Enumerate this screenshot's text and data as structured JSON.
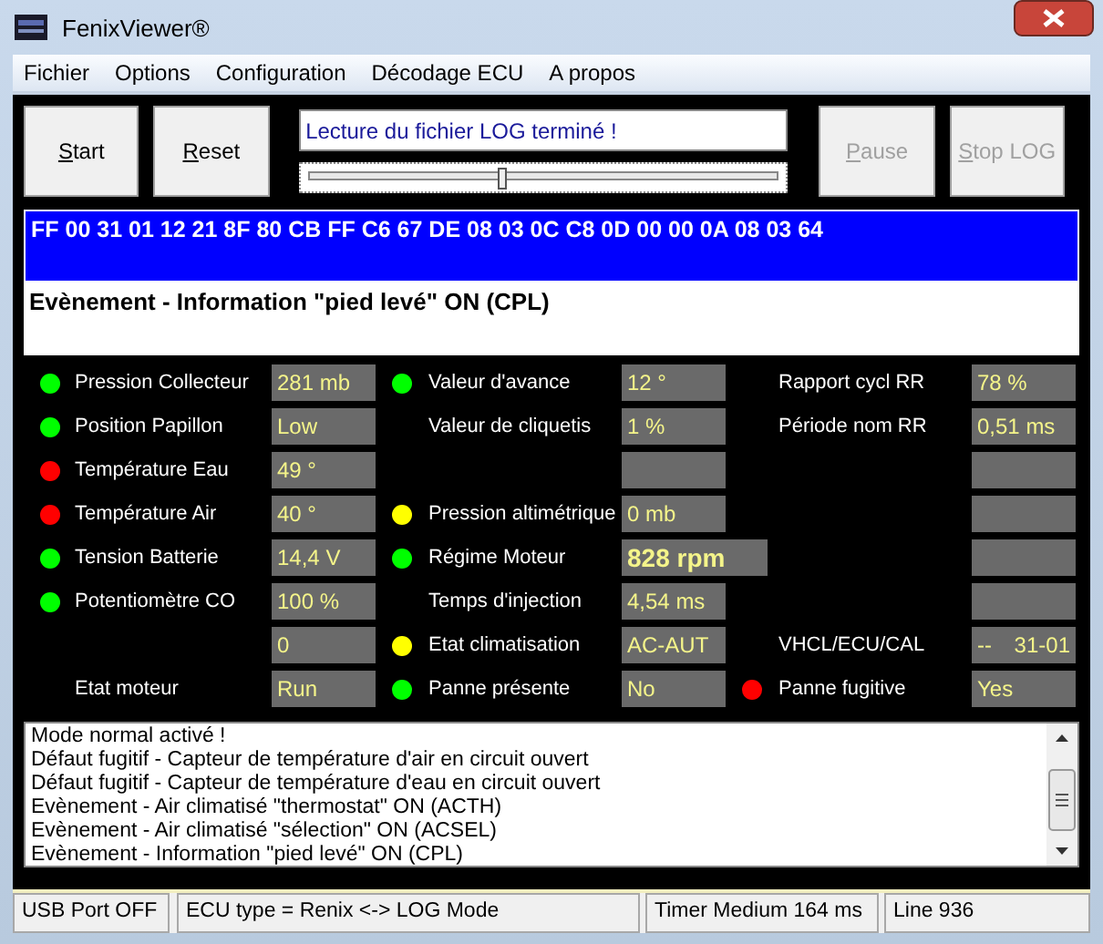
{
  "window": {
    "title": "FenixViewer®"
  },
  "menu": [
    "Fichier",
    "Options",
    "Configuration",
    "Décodage ECU",
    "A propos"
  ],
  "buttons_left": [
    {
      "label": "Start",
      "disabled": false
    },
    {
      "label": "Reset",
      "disabled": false
    }
  ],
  "message": {
    "value": "Lecture du fichier LOG terminé !"
  },
  "progress": {
    "level": 0.4
  },
  "buttons_right": [
    {
      "label": "Pause",
      "disabled": true
    },
    {
      "label": "Stop LOG",
      "disabled": true
    }
  ],
  "frame_hex": "FF 00 31 01 12 21 8F 80 CB FF C6 67 DE 08 03 0C C8 0D 00 00 0A 08 03 64",
  "event": "Evènement - Information \"pied levé\" ON (CPL)",
  "grid": [
    [
      {
        "color": "#00ff00",
        "label": "Pression Collecteur",
        "value": "281 mb",
        "box": true
      },
      {
        "color": "#00ff00",
        "label": "Valeur d'avance",
        "value": "12 °",
        "box": true
      },
      {
        "label": "Rapport cycl RR",
        "value": "78 %",
        "box": true
      }
    ],
    [
      {
        "color": "#00ff00",
        "label": "Position Papillon",
        "value": "Low",
        "box": true
      },
      {
        "label": "Valeur de cliquetis",
        "value": "1 %",
        "box": true
      },
      {
        "label": "Période nom RR",
        "value": "0,51 ms",
        "box": true
      }
    ],
    [
      {
        "color": "#ff0000",
        "label": "Température Eau",
        "value": "49 °",
        "box": true
      },
      {
        "box": true
      },
      {
        "box": true
      }
    ],
    [
      {
        "color": "#ff0000",
        "label": "Température Air",
        "value": "40 °",
        "box": true
      },
      {
        "color": "#ffff00",
        "label": "Pression altimétrique",
        "value": "0 mb",
        "box": true
      },
      {
        "box": true
      }
    ],
    [
      {
        "color": "#00ff00",
        "label": "Tension Batterie",
        "value": "14,4 V",
        "box": true
      },
      {
        "color": "#00ff00",
        "label": "Régime Moteur",
        "value": "828 rpm",
        "box": true,
        "emphasis": true
      },
      {
        "box": true
      }
    ],
    [
      {
        "color": "#00ff00",
        "label": "Potentiomètre CO",
        "value": "100 %",
        "box": true
      },
      {
        "label": "Temps d'injection",
        "value": "4,54 ms",
        "box": true
      },
      {
        "box": true
      }
    ],
    [
      {
        "value": "0",
        "box": true
      },
      {
        "color": "#ffff00",
        "label": "Etat climatisation",
        "value": "AC-AUT",
        "box": true
      },
      {
        "label": "VHCL/ECU/CAL",
        "value": "--",
        "value_end": "31-01",
        "box": true
      }
    ],
    [
      {
        "label": "Etat moteur",
        "value": "Run",
        "box": true
      },
      {
        "color": "#00ff00",
        "label": "Panne présente",
        "value": "No",
        "box": true
      },
      {
        "color": "#ff0000",
        "label": "Panne fugitive",
        "value": "Yes",
        "box": true
      }
    ]
  ],
  "log": [
    "Mode normal activé !",
    "Défaut fugitif - Capteur de température d'air en circuit ouvert",
    "Défaut fugitif - Capteur de température d'eau en circuit ouvert",
    "Evènement - Air climatisé \"thermostat\" ON (ACTH)",
    "Evènement - Air climatisé \"sélection\" ON (ACSEL)",
    "Evènement - Information \"pied levé\" ON (CPL)"
  ],
  "status_bar": [
    "USB Port OFF",
    "ECU type = Renix <-> LOG Mode",
    "Timer Medium 164 ms",
    "Line 936"
  ]
}
